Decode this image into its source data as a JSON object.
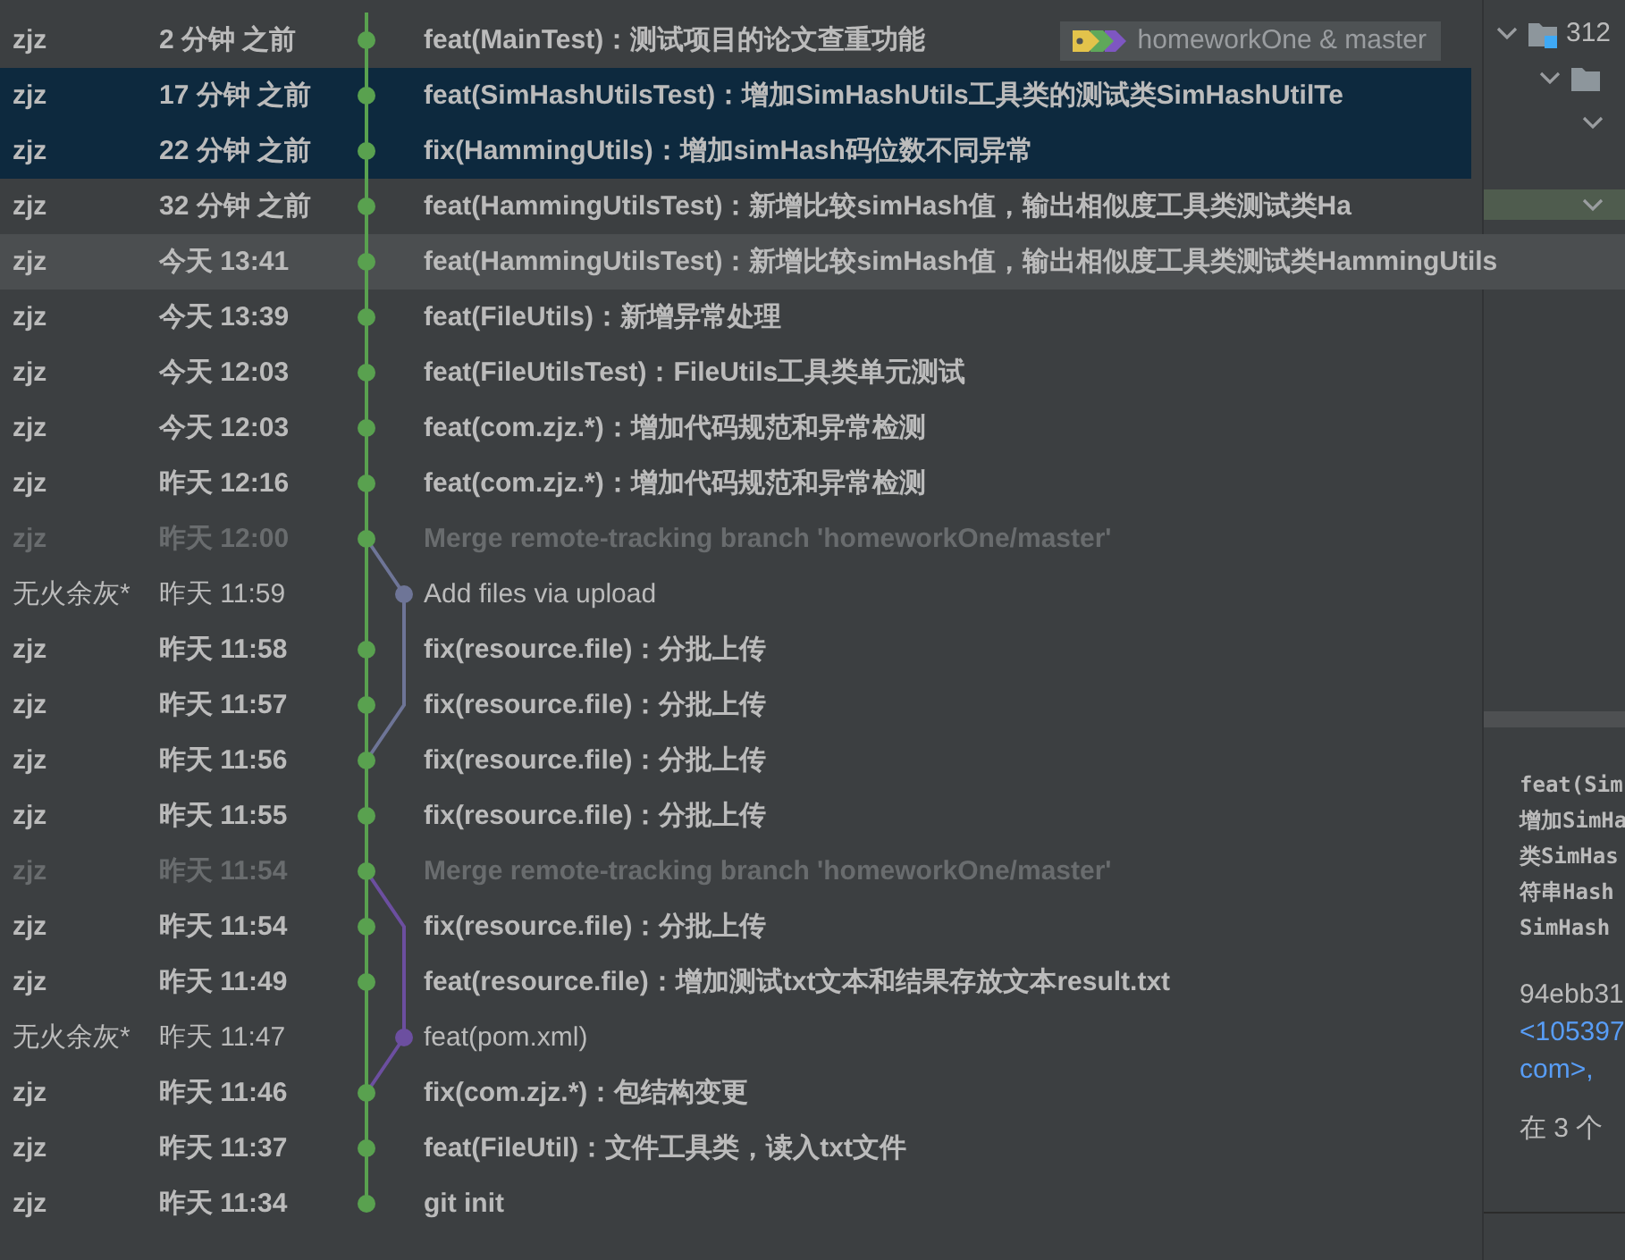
{
  "log": {
    "rows": [
      {
        "author": "zjz",
        "date": "2 分钟 之前",
        "message": "feat(MainTest)：测试项目的论文查重功能",
        "kind": "own",
        "side_branch": false,
        "selected": false,
        "hovered": false,
        "tag": "homeworkOne & master"
      },
      {
        "author": "zjz",
        "date": "17 分钟 之前",
        "message": "feat(SimHashUtilsTest)：增加SimHashUtils工具类的测试类SimHashUtilTe",
        "kind": "own",
        "side_branch": false,
        "selected": true,
        "hovered": false
      },
      {
        "author": "zjz",
        "date": "22 分钟 之前",
        "message": "fix(HammingUtils)：增加simHash码位数不同异常",
        "kind": "own",
        "side_branch": false,
        "selected": true,
        "hovered": false
      },
      {
        "author": "zjz",
        "date": "32 分钟 之前",
        "message": "feat(HammingUtilsTest)：新增比较simHash值，输出相似度工具类测试类Ha",
        "kind": "own",
        "side_branch": false,
        "selected": false,
        "hovered": false
      },
      {
        "author": "zjz",
        "date": "今天 13:41",
        "message": "feat(HammingUtilsTest)：新增比较simHash值，输出相似度工具类测试类HammingUtils",
        "kind": "own",
        "side_branch": false,
        "selected": false,
        "hovered": true
      },
      {
        "author": "zjz",
        "date": "今天 13:39",
        "message": "feat(FileUtils)：新增异常处理",
        "kind": "own",
        "side_branch": false,
        "selected": false,
        "hovered": false
      },
      {
        "author": "zjz",
        "date": "今天 12:03",
        "message": "feat(FileUtilsTest)：FileUtils工具类单元测试",
        "kind": "own",
        "side_branch": false,
        "selected": false,
        "hovered": false
      },
      {
        "author": "zjz",
        "date": "今天 12:03",
        "message": "feat(com.zjz.*)：增加代码规范和异常检测",
        "kind": "own",
        "side_branch": false,
        "selected": false,
        "hovered": false
      },
      {
        "author": "zjz",
        "date": "昨天 12:16",
        "message": "feat(com.zjz.*)：增加代码规范和异常检测",
        "kind": "own",
        "side_branch": false,
        "selected": false,
        "hovered": false
      },
      {
        "author": "zjz",
        "date": "昨天 12:00",
        "message": "Merge remote-tracking branch 'homeworkOne/master'",
        "kind": "merge",
        "side_branch": false,
        "selected": false,
        "hovered": false
      },
      {
        "author": "无火余灰*",
        "date": "昨天 11:59",
        "message": "Add files via upload",
        "kind": "other",
        "side_branch": true,
        "color": "#6e7597",
        "selected": false,
        "hovered": false
      },
      {
        "author": "zjz",
        "date": "昨天 11:58",
        "message": "fix(resource.file)：分批上传",
        "kind": "own",
        "side_branch": false,
        "selected": false,
        "hovered": false
      },
      {
        "author": "zjz",
        "date": "昨天 11:57",
        "message": "fix(resource.file)：分批上传",
        "kind": "own",
        "side_branch": false,
        "selected": false,
        "hovered": false
      },
      {
        "author": "zjz",
        "date": "昨天 11:56",
        "message": "fix(resource.file)：分批上传",
        "kind": "own",
        "side_branch": false,
        "selected": false,
        "hovered": false
      },
      {
        "author": "zjz",
        "date": "昨天 11:55",
        "message": "fix(resource.file)：分批上传",
        "kind": "own",
        "side_branch": false,
        "selected": false,
        "hovered": false
      },
      {
        "author": "zjz",
        "date": "昨天 11:54",
        "message": "Merge remote-tracking branch 'homeworkOne/master'",
        "kind": "merge",
        "side_branch": false,
        "selected": false,
        "hovered": false
      },
      {
        "author": "zjz",
        "date": "昨天 11:54",
        "message": "fix(resource.file)：分批上传",
        "kind": "own",
        "side_branch": false,
        "selected": false,
        "hovered": false
      },
      {
        "author": "zjz",
        "date": "昨天 11:49",
        "message": "feat(resource.file)：增加测试txt文本和结果存放文本result.txt",
        "kind": "own",
        "side_branch": false,
        "selected": false,
        "hovered": false
      },
      {
        "author": "无火余灰*",
        "date": "昨天 11:47",
        "message": "feat(pom.xml)",
        "kind": "other",
        "side_branch": true,
        "color": "#6c4fa0",
        "selected": false,
        "hovered": false
      },
      {
        "author": "zjz",
        "date": "昨天 11:46",
        "message": "fix(com.zjz.*)：包结构变更",
        "kind": "own",
        "side_branch": false,
        "selected": false,
        "hovered": false
      },
      {
        "author": "zjz",
        "date": "昨天 11:37",
        "message": "feat(FileUtil)：文件工具类，读入txt文件",
        "kind": "own",
        "side_branch": false,
        "selected": false,
        "hovered": false
      },
      {
        "author": "zjz",
        "date": "昨天 11:34",
        "message": "git init",
        "kind": "own",
        "side_branch": false,
        "selected": false,
        "hovered": false
      }
    ]
  },
  "changes_tree": [
    {
      "label": "312",
      "expanded": true,
      "selected": false,
      "children": [
        {
          "expanded": true,
          "selected": false,
          "children": [
            {
              "expanded": true,
              "selected": false
            },
            {
              "expanded": true,
              "selected": true
            }
          ]
        }
      ]
    }
  ],
  "details": {
    "message_lines": [
      "feat(Sim",
      "增加SimHa",
      "类SimHas",
      "符串Hash",
      "SimHash"
    ],
    "hash": "94ebb31",
    "email_lines": [
      "<105397",
      "com>,"
    ],
    "summary": "在 3 个"
  }
}
